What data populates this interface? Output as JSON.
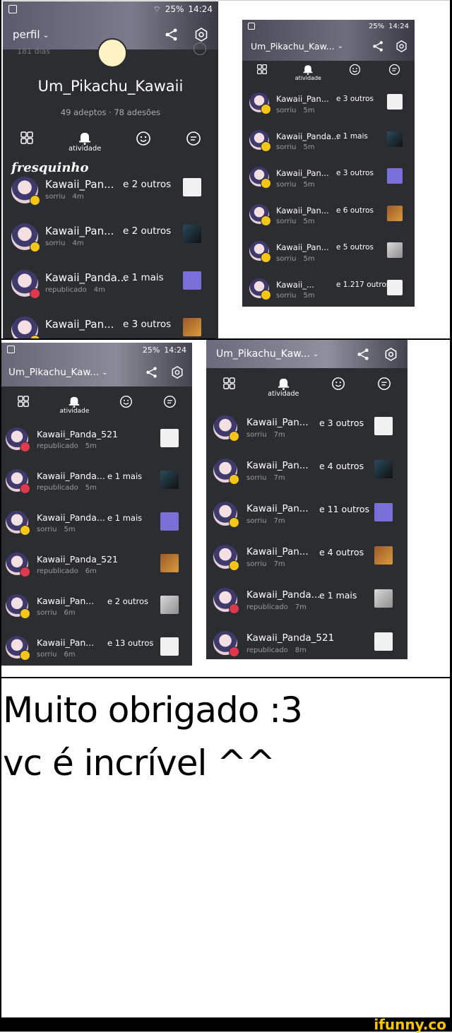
{
  "panel1": {
    "status": {
      "signal": "25%",
      "time": "14:24"
    },
    "header_title": "perfil",
    "top_fragment": "181 dias",
    "profile_name": "Um_Pikachu_Kawaii",
    "followers": "49 adeptos",
    "dot": "·",
    "joined": "78 adesões",
    "tab_label": "atividade",
    "section_title": "fresquinho",
    "rows": [
      {
        "name": "Kawaii_Pan...",
        "extra": "e 2 outros",
        "action": "sorriu",
        "time": "4m",
        "badge": "smile"
      },
      {
        "name": "Kawaii_Pan...",
        "extra": "e 2 outros",
        "action": "sorriu",
        "time": "4m",
        "badge": "smile"
      },
      {
        "name": "Kawaii_Panda...",
        "extra": "e 1 mais",
        "action": "republicado",
        "time": "4m",
        "badge": "repost"
      },
      {
        "name": "Kawaii_Pan...",
        "extra": "e 3 outros",
        "action": "",
        "time": "",
        "badge": "smile"
      }
    ]
  },
  "panel2": {
    "status": {
      "signal": "25%",
      "time": "14:24"
    },
    "header_title": "Um_Pikachu_Kaw...",
    "tab_label": "atividade",
    "rows": [
      {
        "name": "Kawaii_Pan...",
        "extra": "e 3 outros",
        "action": "sorriu",
        "time": "5m",
        "badge": "smile"
      },
      {
        "name": "Kawaii_Panda...",
        "extra": "e 1 mais",
        "action": "sorriu",
        "time": "5m",
        "badge": "smile"
      },
      {
        "name": "Kawaii_Pan...",
        "extra": "e 3 outros",
        "action": "sorriu",
        "time": "5m",
        "badge": "smile"
      },
      {
        "name": "Kawaii_Pan...",
        "extra": "e 6 outros",
        "action": "sorriu",
        "time": "5m",
        "badge": "smile"
      },
      {
        "name": "Kawaii_Pan...",
        "extra": "e 5 outros",
        "action": "sorriu",
        "time": "5m",
        "badge": "smile"
      },
      {
        "name": "Kawaii_...",
        "extra": "e 1.217 outros",
        "action": "sorriu",
        "time": "5m",
        "badge": "smile"
      }
    ]
  },
  "panel3": {
    "status": {
      "signal": "25%",
      "time": "14:24"
    },
    "header_title": "Um_Pikachu_Kaw...",
    "tab_label": "atividade",
    "rows": [
      {
        "name": "Kawaii_Panda_521",
        "extra": "",
        "action": "republicado",
        "time": "5m",
        "badge": "repost"
      },
      {
        "name": "Kawaii_Panda...",
        "extra": "e 1 mais",
        "action": "republicado",
        "time": "5m",
        "badge": "repost"
      },
      {
        "name": "Kawaii_Panda...",
        "extra": "e 1 mais",
        "action": "sorriu",
        "time": "5m",
        "badge": "smile"
      },
      {
        "name": "Kawaii_Panda_521",
        "extra": "",
        "action": "republicado",
        "time": "6m",
        "badge": "repost"
      },
      {
        "name": "Kawaii_Pan...",
        "extra": "e 2 outros",
        "action": "sorriu",
        "time": "6m",
        "badge": "smile"
      },
      {
        "name": "Kawaii_Pan...",
        "extra": "e 13 outros",
        "action": "sorriu",
        "time": "6m",
        "badge": "smile"
      }
    ]
  },
  "panel4": {
    "header_title": "Um_Pikachu_Kaw...",
    "tab_label": "atividade",
    "rows": [
      {
        "name": "Kawaii_Pan...",
        "extra": "e 3 outros",
        "action": "sorriu",
        "time": "7m",
        "badge": "smile"
      },
      {
        "name": "Kawaii_Pan...",
        "extra": "e 4 outros",
        "action": "sorriu",
        "time": "7m",
        "badge": "smile"
      },
      {
        "name": "Kawaii_Pan...",
        "extra": "e 11 outros",
        "action": "sorriu",
        "time": "7m",
        "badge": "smile"
      },
      {
        "name": "Kawaii_Pan...",
        "extra": "e 4 outros",
        "action": "sorriu",
        "time": "7m",
        "badge": "smile"
      },
      {
        "name": "Kawaii_Panda...",
        "extra": "e 1 mais",
        "action": "republicado",
        "time": "7m",
        "badge": "repost"
      },
      {
        "name": "Kawaii_Panda_521",
        "extra": "",
        "action": "republicado",
        "time": "8m",
        "badge": "repost"
      }
    ]
  },
  "caption": {
    "line1": "Muito obrigado :3",
    "line2": "vc é incrível ^^"
  },
  "watermark": "ifunny.co",
  "colors": {
    "panel_bg": "#2c2d31",
    "smile_badge": "#f5c518",
    "repost_badge": "#e0384d",
    "logo": "#f7c600"
  }
}
